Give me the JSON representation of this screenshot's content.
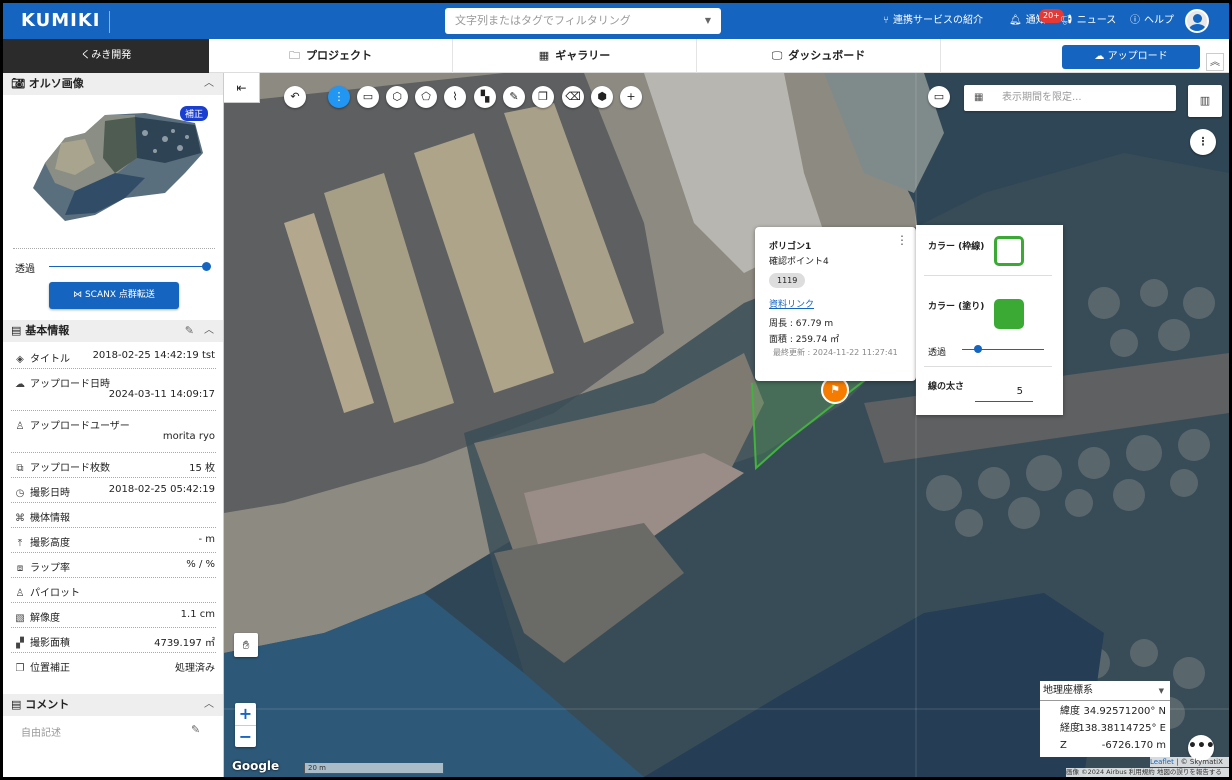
{
  "header": {
    "logo": "KUMIKI",
    "search_placeholder": "文字列またはタグでフィルタリング",
    "nav": {
      "services": "連携サービスの紹介",
      "notify": "通知",
      "notify_badge": "20+",
      "news": "ニュース",
      "help": "ヘルプ"
    }
  },
  "secbar": {
    "org": "くみき開発",
    "tabs": [
      "プロジェクト",
      "ギャラリー",
      "ダッシュボード"
    ],
    "upload": "アップロード"
  },
  "sidebar": {
    "ortho": {
      "title": "オルソ画像",
      "badge": "補正",
      "opacity_label": "透過",
      "opacity_value": 1.0,
      "scanx_button": "SCANX 点群転送"
    },
    "basic": {
      "title": "基本情報",
      "rows": [
        {
          "label": "タイトル",
          "value": "2018-02-25 14:42:19 tst"
        },
        {
          "label": "アップロード日時",
          "value": "2024-03-11 14:09:17"
        },
        {
          "label": "アップロードユーザー",
          "value": "morita ryo"
        },
        {
          "label": "アップロード枚数",
          "value": "15 枚"
        },
        {
          "label": "撮影日時",
          "value": "2018-02-25 05:42:19"
        },
        {
          "label": "機体情報",
          "value": ""
        },
        {
          "label": "撮影高度",
          "value": "- m"
        },
        {
          "label": "ラップ率",
          "value": "% / %"
        },
        {
          "label": "パイロット",
          "value": ""
        },
        {
          "label": "解像度",
          "value": "1.1 cm"
        },
        {
          "label": "撮影面積",
          "value": "4739.197 ㎡"
        },
        {
          "label": "位置補正",
          "value": "処理済み"
        }
      ]
    },
    "comment": {
      "title": "コメント",
      "placeholder": "自由記述"
    }
  },
  "map": {
    "date_placeholder": "表示期間を限定...",
    "popup": {
      "title": "ポリゴン1",
      "subtitle": "確認ポイント4",
      "chip": "1119",
      "link": "資料リンク",
      "perimeter": "周長 : 67.79 m",
      "area": "面積 : 259.74 ㎡",
      "updated": "最終更新 : 2024-11-22 11:27:41"
    },
    "style": {
      "outline_label": "カラー (枠線)",
      "fill_label": "カラー (塗り)",
      "opacity_label": "透過",
      "opacity_value": 0.2,
      "width_label": "線の太さ",
      "width_value": "5",
      "outline_color": "#3aaa35",
      "fill_color": "#3aaa35"
    },
    "coords": {
      "system": "地理座標系",
      "rows": [
        {
          "k": "緯度",
          "v": "34.92571200° N"
        },
        {
          "k": "経度",
          "v": "138.38114725° E"
        },
        {
          "k": "Z",
          "v": "-6726.170 m"
        }
      ]
    },
    "google": "Google",
    "scale": "20 m",
    "attrib": {
      "leaflet": "Leaflet",
      "rest": " | © SkymatiX",
      "line2": "画像 ©2024 Airbus  利用規約  地図の誤りを報告する"
    }
  }
}
